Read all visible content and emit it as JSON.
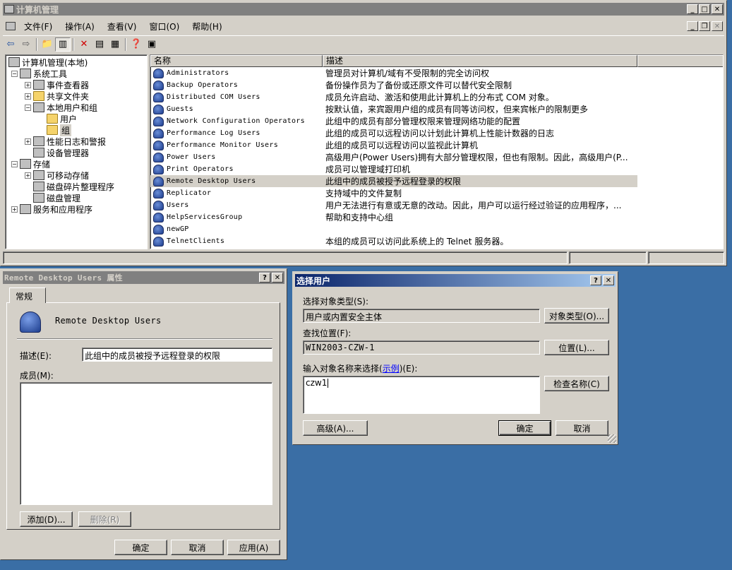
{
  "mmc": {
    "title": "计算机管理",
    "menu": [
      "文件(F)",
      "操作(A)",
      "查看(V)",
      "窗口(O)",
      "帮助(H)"
    ],
    "tree": [
      {
        "label": "计算机管理(本地)",
        "level": 0,
        "icon": "computer-icon"
      },
      {
        "label": "系统工具",
        "level": 1,
        "icon": "tools-icon",
        "expander": "−"
      },
      {
        "label": "事件查看器",
        "level": 2,
        "icon": "event-viewer-icon",
        "expander": "+"
      },
      {
        "label": "共享文件夹",
        "level": 2,
        "icon": "shared-folder-icon",
        "expander": "+"
      },
      {
        "label": "本地用户和组",
        "level": 2,
        "icon": "users-groups-icon",
        "expander": "−"
      },
      {
        "label": "用户",
        "level": 3,
        "icon": "folder-icon"
      },
      {
        "label": "组",
        "level": 3,
        "icon": "folder-open-icon",
        "selected": true
      },
      {
        "label": "性能日志和警报",
        "level": 2,
        "icon": "performance-icon",
        "expander": "+"
      },
      {
        "label": "设备管理器",
        "level": 2,
        "icon": "device-manager-icon"
      },
      {
        "label": "存储",
        "level": 1,
        "icon": "storage-icon",
        "expander": "−"
      },
      {
        "label": "可移动存储",
        "level": 2,
        "icon": "removable-storage-icon",
        "expander": "+"
      },
      {
        "label": "磁盘碎片整理程序",
        "level": 2,
        "icon": "defrag-icon"
      },
      {
        "label": "磁盘管理",
        "level": 2,
        "icon": "disk-management-icon"
      },
      {
        "label": "服务和应用程序",
        "level": 1,
        "icon": "services-icon",
        "expander": "+"
      }
    ],
    "list": {
      "headers": [
        "名称",
        "描述"
      ],
      "rows": [
        {
          "name": "Administrators",
          "desc": "管理员对计算机/域有不受限制的完全访问权"
        },
        {
          "name": "Backup Operators",
          "desc": "备份操作员为了备份或还原文件可以替代安全限制"
        },
        {
          "name": "Distributed COM Users",
          "desc": "成员允许启动、激活和使用此计算机上的分布式 COM 对象。"
        },
        {
          "name": "Guests",
          "desc": "按默认值，来宾跟用户组的成员有同等访问权，但来宾帐户的限制更多"
        },
        {
          "name": "Network Configuration Operators",
          "desc": "此组中的成员有部分管理权限来管理网络功能的配置"
        },
        {
          "name": "Performance Log Users",
          "desc": "此组的成员可以远程访问以计划此计算机上性能计数器的日志"
        },
        {
          "name": "Performance Monitor Users",
          "desc": "此组的成员可以远程访问以监视此计算机"
        },
        {
          "name": "Power Users",
          "desc": "高级用户(Power Users)拥有大部分管理权限，但也有限制。因此，高级用户(P..."
        },
        {
          "name": "Print Operators",
          "desc": "成员可以管理域打印机"
        },
        {
          "name": "Remote Desktop Users",
          "desc": "此组中的成员被授予远程登录的权限",
          "selected": true
        },
        {
          "name": "Replicator",
          "desc": "支持域中的文件复制"
        },
        {
          "name": "Users",
          "desc": "用户无法进行有意或无意的改动。因此，用户可以运行经过验证的应用程序，..."
        },
        {
          "name": "HelpServicesGroup",
          "desc": "帮助和支持中心组"
        },
        {
          "name": "newGP",
          "desc": ""
        },
        {
          "name": "TelnetClients",
          "desc": "本组的成员可以访问此系统上的 Telnet 服务器。"
        }
      ]
    }
  },
  "props": {
    "title": "Remote Desktop Users 属性",
    "tab": "常规",
    "group_name": "Remote Desktop Users",
    "desc_label": "描述(E):",
    "desc_value": "此组中的成员被授予远程登录的权限",
    "members_label": "成员(M):",
    "add_label": "添加(D)...",
    "remove_label": "删除(R)",
    "ok_label": "确定",
    "cancel_label": "取消",
    "apply_label": "应用(A)"
  },
  "seluser": {
    "title": "选择用户",
    "type_label": "选择对象类型(S):",
    "type_value": "用户或内置安全主体",
    "type_button": "对象类型(O)...",
    "loc_label": "查找位置(F):",
    "loc_value": "WIN2003-CZW-1",
    "loc_button": "位置(L)...",
    "name_label_pre": "输入对象名称来选择(",
    "name_label_link": "示例",
    "name_label_post": ")(E):",
    "name_value": "czw1",
    "check_button": "检查名称(C)",
    "advanced_button": "高级(A)...",
    "ok_label": "确定",
    "cancel_label": "取消"
  },
  "window_buttons": {
    "minimize": "_",
    "maximize": "□",
    "restore": "❐",
    "close": "✕",
    "help": "?"
  }
}
